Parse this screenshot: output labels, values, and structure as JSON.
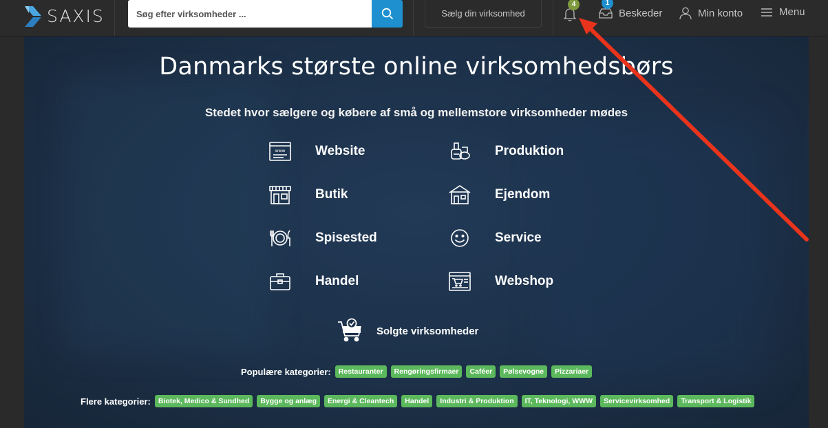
{
  "header": {
    "logo_text": "SAXIS",
    "search_placeholder": "Søg efter virksomheder ...",
    "sell_label": "Sælg din virksomhed",
    "notifications_count": "4",
    "messages_count": "1",
    "messages_label": "Beskeder",
    "account_label": "Min konto",
    "menu_label": "Menu"
  },
  "hero": {
    "title": "Danmarks største online virksomhedsbørs",
    "subtitle": "Stedet hvor sælgere og købere af små og mellemstore virksomheder mødes",
    "categories": [
      {
        "label": "Website",
        "icon": "website-icon"
      },
      {
        "label": "Produktion",
        "icon": "production-icon"
      },
      {
        "label": "Butik",
        "icon": "shop-icon"
      },
      {
        "label": "Ejendom",
        "icon": "property-icon"
      },
      {
        "label": "Spisested",
        "icon": "restaurant-icon"
      },
      {
        "label": "Service",
        "icon": "smiley-icon"
      },
      {
        "label": "Handel",
        "icon": "briefcase-icon"
      },
      {
        "label": "Webshop",
        "icon": "webshop-icon"
      }
    ],
    "sold_label": "Solgte virksomheder",
    "popular_label": "Populære kategorier:",
    "popular_tags": [
      "Restauranter",
      "Rengøringsfirmaer",
      "Caféer",
      "Pølsevogne",
      "Pizzariaer"
    ],
    "more_label": "Flere kategorier:",
    "more_tags": [
      "Biotek, Medico & Sundhed",
      "Bygge og anlæg",
      "Energi & Cleantech",
      "Handel",
      "Industri & Produktion",
      "IT, Teknologi, WWW",
      "Servicevirksomhed",
      "Transport & Logistik"
    ]
  },
  "colors": {
    "accent_blue": "#1e90d0",
    "tag_green": "#5cb85c",
    "badge_green": "#7f9a3e",
    "annotation_arrow": "#e8341c"
  }
}
